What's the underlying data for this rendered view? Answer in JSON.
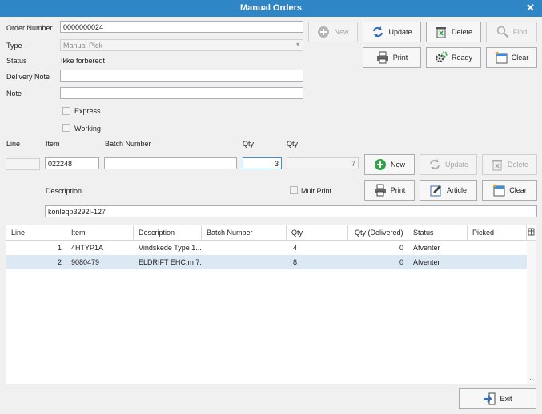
{
  "window": {
    "title": "Manual Orders",
    "close": "✕"
  },
  "header": {
    "order_number_label": "Order Number",
    "order_number": "0000000024",
    "type_label": "Type",
    "type_value": "Manual Pick",
    "status_label": "Status",
    "status_value": "Ikke forberedt",
    "delivery_note_label": "Delivery Note",
    "delivery_note": "",
    "note_label": "Note",
    "note": "",
    "express_label": "Express",
    "working_label": "Working"
  },
  "order_buttons": {
    "new": "New",
    "update": "Update",
    "delete": "Delete",
    "find": "Find",
    "print": "Print",
    "ready": "Ready",
    "clear": "Clear"
  },
  "line_editor": {
    "line_label": "Line",
    "item_label": "Item",
    "batch_label": "Batch Number",
    "qty_label": "Qty",
    "qty2_label": "Qty",
    "line_value": "",
    "item_value": "022248",
    "batch_value": "",
    "qty_value": "3",
    "qty2_value": "7",
    "description_label": "Description",
    "mult_print_label": "Mult Print",
    "description_value": "konleqp3292I-127"
  },
  "line_buttons": {
    "new": "New",
    "update": "Update",
    "delete": "Delete",
    "print": "Print",
    "article": "Article",
    "clear": "Clear"
  },
  "grid": {
    "columns": [
      "Line",
      "Item",
      "Description",
      "Batch Number",
      "Qty",
      "Qty (Delivered)",
      "Status",
      "Picked"
    ],
    "rows": [
      {
        "line": "1",
        "item": "4HTYP1A",
        "description": "Vindskede Type 1...",
        "batch": "",
        "qty": "4",
        "delivered": "0",
        "status": "Afventer",
        "picked": ""
      },
      {
        "line": "2",
        "item": "9080479",
        "description": "ELDRIFT EHC,m  7...",
        "batch": "",
        "qty": "8",
        "delivered": "0",
        "status": "Afventer",
        "picked": ""
      }
    ]
  },
  "footer": {
    "exit": "Exit"
  },
  "colors": {
    "titlebar": "#2f86c7",
    "selected_row": "#dde8f5",
    "accent_green": "#2fa34a"
  }
}
